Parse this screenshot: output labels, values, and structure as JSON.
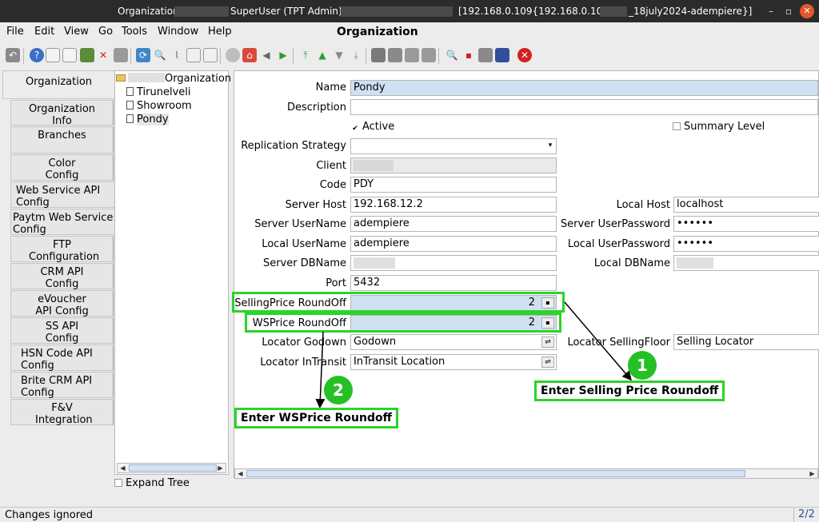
{
  "titlebar": {
    "app": "Organization",
    "user": "SuperUser (TPT Admin) @",
    "server": "[192.168.0.109{192.168.0.109-",
    "server_suffix": "_18july2024-adempiere}]",
    "minimize_glyph": "–",
    "maximize_glyph": "▫",
    "close_glyph": "✕"
  },
  "menu": {
    "items": [
      "File",
      "Edit",
      "View",
      "Go",
      "Tools",
      "Window",
      "Help"
    ],
    "window_title": "Organization"
  },
  "toolbar": {
    "icons": [
      "undo-icon",
      "help-icon",
      "new-icon",
      "copy-icon",
      "delete-icon",
      "delete-selection-icon",
      "save-icon",
      "refresh-icon",
      "find-icon",
      "attachment-icon",
      "chat-icon",
      "grid-toggle-icon",
      "history-icon",
      "home-icon",
      "parent-icon",
      "detail-icon",
      "first-record-icon",
      "previous-record-icon",
      "next-record-icon",
      "last-record-icon",
      "report-icon",
      "archive-icon",
      "print-preview-icon",
      "print-icon",
      "zoom-across-icon",
      "active-workflows-icon",
      "requests-icon",
      "product-info-icon",
      "exit-icon"
    ]
  },
  "tabs": [
    "Organization",
    "Organization Info",
    "Branches",
    "Color Config",
    "Web Service API Config",
    "Paytm Web Service Config",
    "FTP Configuration",
    "CRM API Config",
    "eVoucher API Config",
    "SS API Config",
    "HSN Code API Config",
    "Brite CRM API Config",
    "F&V Integration"
  ],
  "tree": {
    "root": "Organization",
    "children": [
      "Tirunelveli",
      "Showroom",
      "Pondy"
    ],
    "selected": "Pondy",
    "expand_label": "Expand Tree"
  },
  "form": {
    "name_label": "Name",
    "name_value": "Pondy",
    "description_label": "Description",
    "description_value": "",
    "active_label": "Active",
    "summary_label": "Summary Level",
    "replication_label": "Replication Strategy",
    "client_label": "Client",
    "code_label": "Code",
    "code_value": "PDY",
    "server_host_label": "Server Host",
    "server_host_value": "192.168.12.2",
    "local_host_label": "Local Host",
    "local_host_value": "localhost",
    "server_user_label": "Server UserName",
    "server_user_value": "adempiere",
    "server_pwd_label": "Server UserPassword",
    "server_pwd_value": "••••••",
    "local_user_label": "Local UserName",
    "local_user_value": "adempiere",
    "local_pwd_label": "Local UserPassword",
    "local_pwd_value": "••••••",
    "server_db_label": "Server DBName",
    "local_db_label": "Local DBName",
    "port_label": "Port",
    "port_value": "5432",
    "selling_roundoff_label": "SellingPrice RoundOff",
    "selling_roundoff_value": "2",
    "ws_roundoff_label": "WSPrice RoundOff",
    "ws_roundoff_value": "2",
    "locator_godown_label": "Locator Godown",
    "locator_godown_value": "Godown",
    "locator_floor_label": "Locator SellingFloor",
    "locator_floor_value": "Selling Locator",
    "locator_transit_label": "Locator InTransit",
    "locator_transit_value": "InTransit Location"
  },
  "annotations": {
    "badge1": "1",
    "callout1": "Enter Selling Price Roundoff",
    "badge2": "2",
    "callout2": "Enter WSPrice Roundoff",
    "color": "#2ad42a"
  },
  "status": {
    "message": "Changes ignored",
    "record": "2/2"
  }
}
